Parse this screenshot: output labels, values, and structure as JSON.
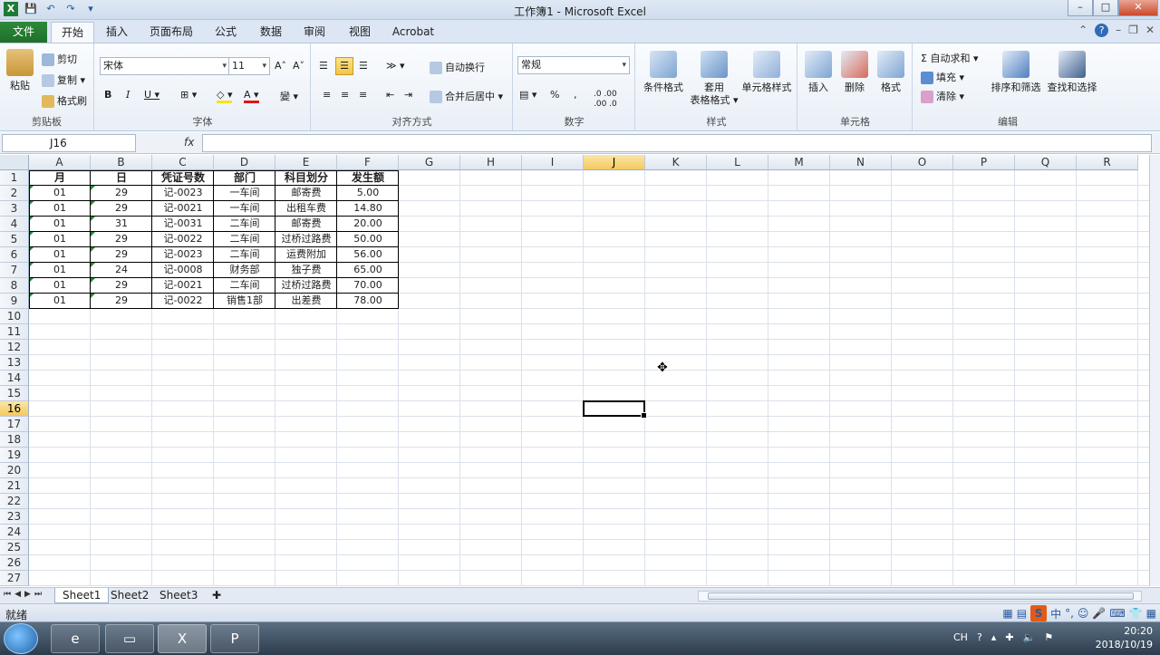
{
  "window": {
    "title": "工作簿1 - Microsoft Excel",
    "min": "–",
    "max": "□",
    "close": "✕"
  },
  "qat": {
    "save": "💾",
    "undo": "↶",
    "redo": "↷",
    "customize": "▾"
  },
  "tabs": [
    {
      "label": "文件"
    },
    {
      "label": "开始"
    },
    {
      "label": "插入"
    },
    {
      "label": "页面布局"
    },
    {
      "label": "公式"
    },
    {
      "label": "数据"
    },
    {
      "label": "审阅"
    },
    {
      "label": "视图"
    },
    {
      "label": "Acrobat"
    }
  ],
  "ribbon": {
    "clipboard": {
      "group": "剪贴板",
      "paste": "粘贴",
      "cut": "剪切",
      "copy": "复制 ▾",
      "painter": "格式刷"
    },
    "font": {
      "group": "字体",
      "name": "宋体",
      "size": "11",
      "grow": "A˄",
      "shrink": "A˅",
      "bold": "B",
      "italic": "I",
      "underline": "U ▾",
      "border": "⊞ ▾",
      "fill": "◇ ▾",
      "color": "A ▾",
      "phonetic": "變 ▾"
    },
    "alignment": {
      "group": "对齐方式",
      "wrap": "自动换行",
      "merge": "合并后居中 ▾",
      "orient": "≫ ▾"
    },
    "number": {
      "group": "数字",
      "format": "常规",
      "currency": "▤ ▾",
      "percent": "%",
      "comma": ",",
      "incdec": ".0 .00",
      "decdec": ".00 .0"
    },
    "styles": {
      "group": "样式",
      "conditional": "条件格式",
      "table_line1": "套用",
      "table_line2": "表格格式 ▾",
      "cellstyles": "单元格样式"
    },
    "cells": {
      "group": "单元格",
      "insert": "插入",
      "delete": "删除",
      "format": "格式"
    },
    "editing": {
      "group": "编辑",
      "autosum": "Σ 自动求和 ▾",
      "fill": "填充 ▾",
      "clear": "清除 ▾",
      "sort": "排序和筛选",
      "find": "查找和选择"
    }
  },
  "formula_bar": {
    "namebox": "J16",
    "fx": "fx",
    "content": ""
  },
  "columns": [
    "A",
    "B",
    "C",
    "D",
    "E",
    "F",
    "G",
    "H",
    "I",
    "J",
    "K",
    "L",
    "M",
    "N",
    "O",
    "P",
    "Q",
    "R"
  ],
  "rows": [
    "1",
    "2",
    "3",
    "4",
    "5",
    "6",
    "7",
    "8",
    "9",
    "10",
    "11",
    "12",
    "13",
    "14",
    "15",
    "16",
    "17",
    "18",
    "19",
    "20",
    "21",
    "22",
    "23",
    "24",
    "25",
    "26",
    "27"
  ],
  "table": {
    "headers": [
      "月",
      "日",
      "凭证号数",
      "部门",
      "科目划分",
      "发生额"
    ],
    "rows": [
      [
        "01",
        "29",
        "记-0023",
        "一车间",
        "邮寄费",
        "5.00"
      ],
      [
        "01",
        "29",
        "记-0021",
        "一车间",
        "出租车费",
        "14.80"
      ],
      [
        "01",
        "31",
        "记-0031",
        "二车间",
        "邮寄费",
        "20.00"
      ],
      [
        "01",
        "29",
        "记-0022",
        "二车间",
        "过桥过路费",
        "50.00"
      ],
      [
        "01",
        "29",
        "记-0023",
        "二车间",
        "运费附加",
        "56.00"
      ],
      [
        "01",
        "24",
        "记-0008",
        "财务部",
        "独子费",
        "65.00"
      ],
      [
        "01",
        "29",
        "记-0021",
        "二车间",
        "过桥过路费",
        "70.00"
      ],
      [
        "01",
        "29",
        "记-0022",
        "销售1部",
        "出差费",
        "78.00"
      ]
    ]
  },
  "selection": {
    "cell": "J16",
    "column": "J",
    "row": "16"
  },
  "sheets": [
    "Sheet1",
    "Sheet2",
    "Sheet3"
  ],
  "status": {
    "ready": "就绪",
    "ime": "中"
  },
  "taskbar": {
    "lang": "CH",
    "time": "20:20",
    "date": "2018/10/19"
  }
}
